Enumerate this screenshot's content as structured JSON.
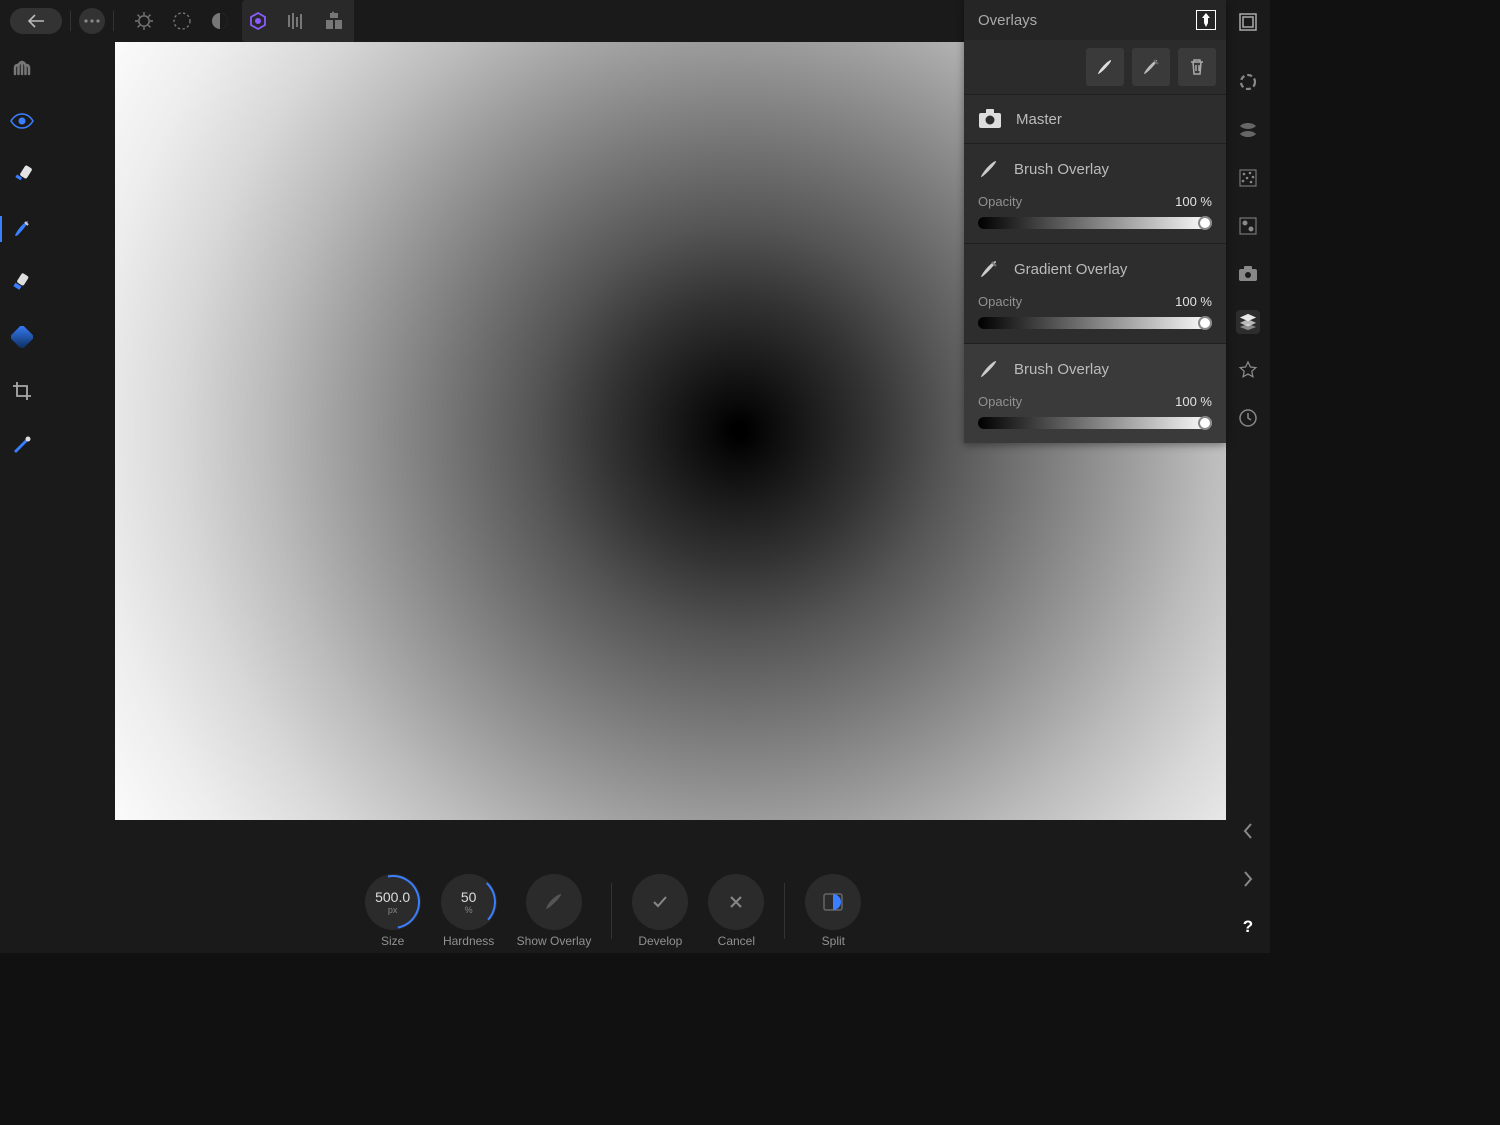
{
  "overlays_panel": {
    "title": "Overlays",
    "master_label": "Master",
    "items": [
      {
        "name": "Brush Overlay",
        "opacity_label": "Opacity",
        "opacity_value": "100 %",
        "selected": false
      },
      {
        "name": "Gradient Overlay",
        "opacity_label": "Opacity",
        "opacity_value": "100 %",
        "selected": false
      },
      {
        "name": "Brush Overlay",
        "opacity_label": "Opacity",
        "opacity_value": "100 %",
        "selected": true
      }
    ]
  },
  "bottom": {
    "size": {
      "value": "500.0",
      "unit": "px",
      "label": "Size"
    },
    "hardness": {
      "value": "50",
      "unit": "%",
      "label": "Hardness"
    },
    "show_overlay": "Show Overlay",
    "develop": "Develop",
    "cancel": "Cancel",
    "split": "Split"
  }
}
